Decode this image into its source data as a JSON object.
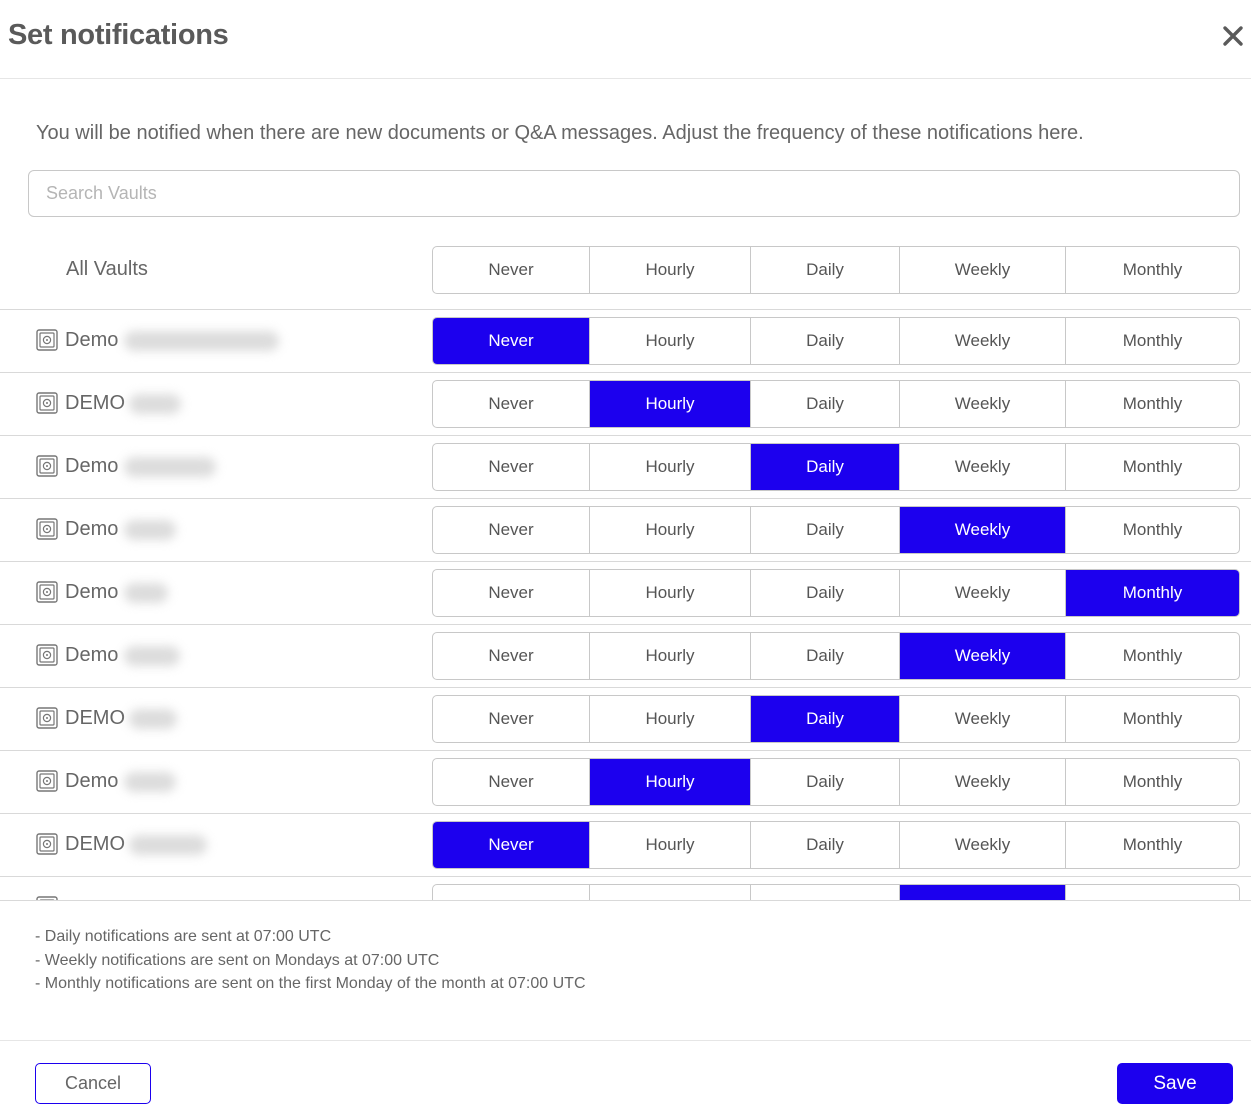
{
  "dialog": {
    "title": "Set notifications",
    "close_icon": "close-icon",
    "intro": "You will be notified when there are new documents or Q&A messages. Adjust the frequency of these notifications here."
  },
  "search": {
    "placeholder": "Search Vaults",
    "value": ""
  },
  "options": [
    "Never",
    "Hourly",
    "Daily",
    "Weekly",
    "Monthly"
  ],
  "accent_color": "#1c00ee",
  "all_vaults": {
    "label": "All Vaults",
    "selected": null
  },
  "vaults": [
    {
      "prefix": "Demo",
      "icon": "vault-icon",
      "selected": "Never"
    },
    {
      "prefix": "DEMO",
      "icon": "vault-icon",
      "selected": "Hourly"
    },
    {
      "prefix": "Demo",
      "icon": "vault-icon",
      "selected": "Daily"
    },
    {
      "prefix": "Demo",
      "icon": "vault-icon",
      "selected": "Weekly"
    },
    {
      "prefix": "Demo",
      "icon": "vault-icon",
      "selected": "Monthly"
    },
    {
      "prefix": "Demo",
      "icon": "vault-icon",
      "selected": "Weekly"
    },
    {
      "prefix": "DEMO",
      "icon": "vault-icon",
      "selected": "Daily"
    },
    {
      "prefix": "Demo",
      "icon": "vault-icon",
      "selected": "Hourly"
    },
    {
      "prefix": "DEMO",
      "icon": "vault-icon",
      "selected": "Never"
    },
    {
      "prefix": "",
      "icon": "vault-icon",
      "selected": "Weekly"
    }
  ],
  "notes": [
    "- Daily notifications are sent at 07:00 UTC",
    "- Weekly notifications are sent on Mondays at 07:00 UTC",
    "- Monthly notifications are sent on the first Monday of the month at 07:00 UTC"
  ],
  "footer": {
    "cancel_label": "Cancel",
    "save_label": "Save"
  }
}
